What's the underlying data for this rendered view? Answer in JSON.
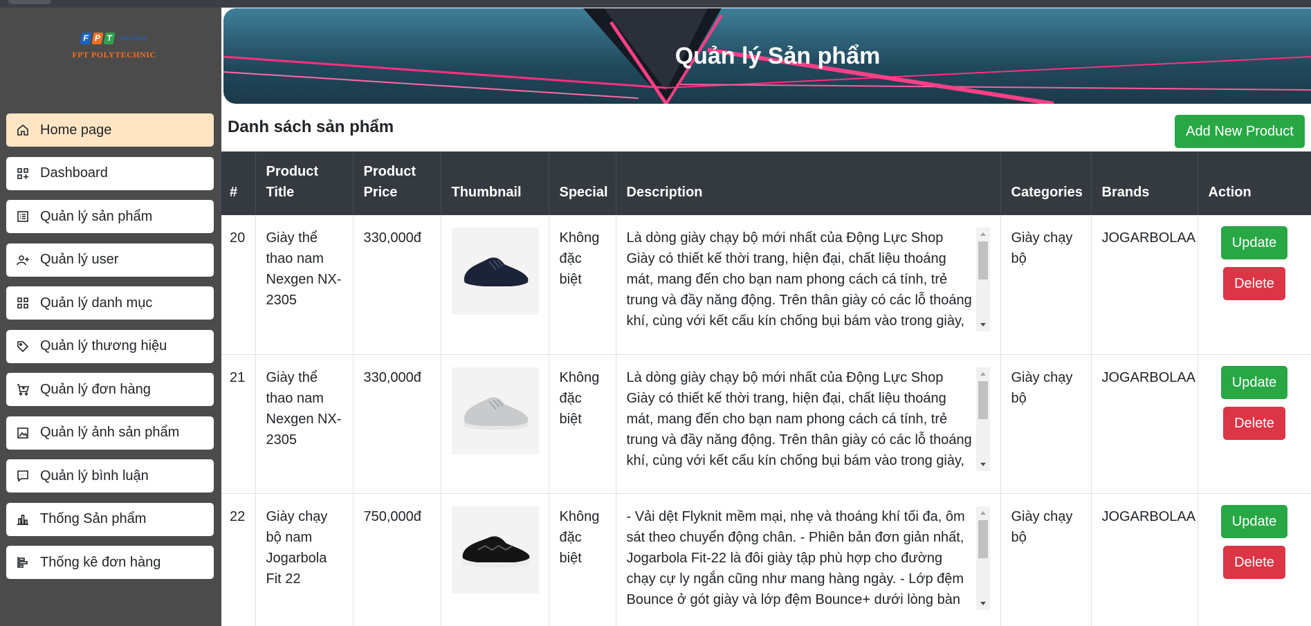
{
  "sidebar": {
    "logo": {
      "text": "FPT POLYTECHNIC",
      "letters": [
        "F",
        "P",
        "T"
      ],
      "sub": "Education"
    },
    "items": [
      {
        "label": "Home page",
        "icon": "home-icon",
        "active": true
      },
      {
        "label": "Dashboard",
        "icon": "dashboard-icon"
      },
      {
        "label": "Quản lý sản phẩm",
        "icon": "list-icon"
      },
      {
        "label": "Quản lý user",
        "icon": "user-plus-icon"
      },
      {
        "label": "Quản lý danh mục",
        "icon": "grid-icon"
      },
      {
        "label": "Quản lý thương hiệu",
        "icon": "tag-icon"
      },
      {
        "label": "Quản lý đơn hàng",
        "icon": "cart-icon"
      },
      {
        "label": "Quản lý ảnh sản phẩm",
        "icon": "image-icon"
      },
      {
        "label": "Quản lý bình luận",
        "icon": "comment-icon"
      },
      {
        "label": "Thống Sản phẩm",
        "icon": "bar-chart-icon"
      },
      {
        "label": "Thống kê đơn hàng",
        "icon": "align-chart-icon"
      }
    ]
  },
  "header": {
    "title": "Quản lý Sản phẩm"
  },
  "main": {
    "list_title": "Danh sách sản phẩm",
    "add_button": "Add New Product",
    "columns": [
      "#",
      "Product Title",
      "Product Price",
      "Thumbnail",
      "Special",
      "Description",
      "Categories",
      "Brands",
      "Action"
    ],
    "rows": [
      {
        "id": "20",
        "title": "Giày thể thao nam Nexgen NX-2305",
        "price": "330,000đ",
        "thumbnail": "navy-sneaker",
        "special": "Không đặc biệt",
        "description": "Là dòng giày chạy bộ mới nhất của Động Lực Shop Giày có thiết kế thời trang, hiện đại, chất liệu thoáng mát, mang đến cho bạn nam phong cách cá tính, trẻ trung và đầy năng động. Trên thân giày có các lỗ thoáng khí, cùng với kết cấu kín chống bụi bám vào trong giày, giúp",
        "category": "Giày chạy bộ",
        "brand": "JOGARBOLAA",
        "update": "Update",
        "delete": "Delete"
      },
      {
        "id": "21",
        "title": "Giày thể thao nam Nexgen NX-2305",
        "price": "330,000đ",
        "thumbnail": "grey-sneaker",
        "special": "Không đặc biệt",
        "description": "Là dòng giày chạy bộ mới nhất của Động Lực Shop Giày có thiết kế thời trang, hiện đại, chất liệu thoáng mát, mang đến cho bạn nam phong cách cá tính, trẻ trung và đầy năng động. Trên thân giày có các lỗ thoáng khí, cùng với kết cấu kín chống bụi bám vào trong giày, giúp",
        "category": "Giày chạy bộ",
        "brand": "JOGARBOLAA",
        "update": "Update",
        "delete": "Delete"
      },
      {
        "id": "22",
        "title": "Giày chạy bộ nam Jogarbola Fit 22",
        "price": "750,000đ",
        "thumbnail": "black-sneaker",
        "special": "Không đặc biệt",
        "description": "- Vải dệt Flyknit mềm mại, nhẹ và thoáng khí tối đa, ôm sát theo chuyển động chân. - Phiên bản đơn giản nhất, Jogarbola Fit-22 là đôi giày tập phù hợp cho đường chạy cự ly ngắn cũng như mang hàng ngày. - Lớp đệm Bounce ở gót giày và lớp đệm Bounce+ dưới lòng bàn",
        "category": "Giày chạy bộ",
        "brand": "JOGARBOLAA",
        "update": "Update",
        "delete": "Delete"
      }
    ]
  },
  "colors": {
    "sidebar_bg": "#4b4b4b",
    "active_item": "#ffe5c4",
    "table_header": "#343a40",
    "success": "#28a745",
    "danger": "#dc3545"
  }
}
